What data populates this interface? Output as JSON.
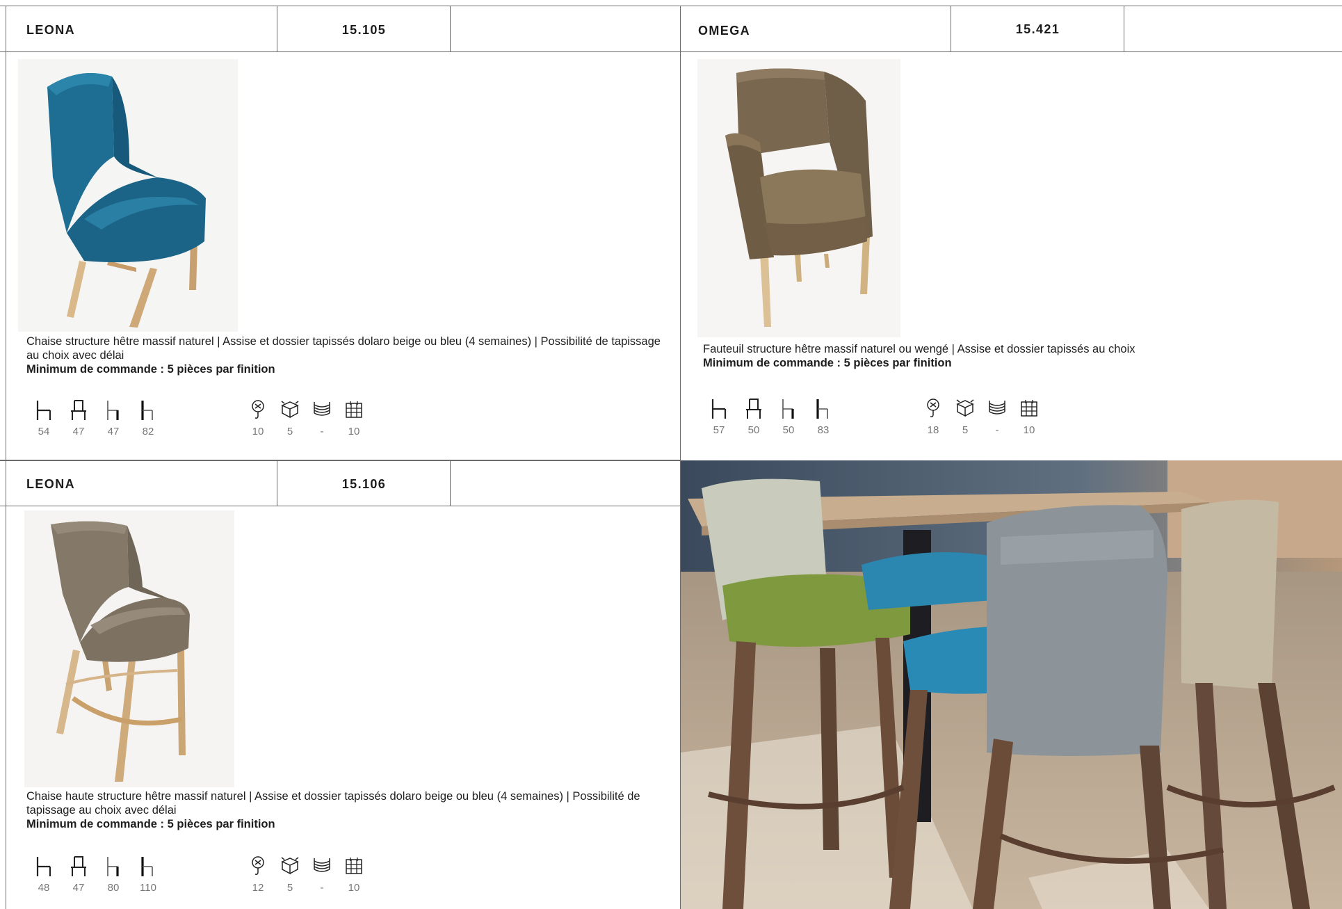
{
  "products": [
    {
      "name": "LEONA",
      "code": "15.105",
      "description": "Chaise structure hêtre massif naturel | Assise et dossier tapissés dolaro beige ou bleu (4 semaines) | Possibilité de tapissage au choix avec délai",
      "minimum": "Minimum de commande : 5 pièces par finition",
      "dimensions": [
        "54",
        "47",
        "47",
        "82"
      ],
      "logistics": [
        "10",
        "5",
        "-",
        "10"
      ],
      "image": "blue-chair-photo",
      "upholstery_color": "#1f6f93"
    },
    {
      "name": "OMEGA",
      "code": "15.421",
      "description": "Fauteuil structure hêtre massif naturel ou wengé | Assise et dossier tapissés au choix",
      "minimum": "Minimum de commande : 5 pièces par finition",
      "dimensions": [
        "57",
        "50",
        "50",
        "83"
      ],
      "logistics": [
        "18",
        "5",
        "-",
        "10"
      ],
      "image": "brown-armchair-photo",
      "upholstery_color": "#7d6a52"
    },
    {
      "name": "LEONA",
      "code": "15.106",
      "description": "Chaise haute structure hêtre massif naturel | Assise et dossier tapissés dolaro beige ou bleu (4 semaines) | Possibilité de tapissage au choix avec délai",
      "minimum": "Minimum de commande : 5 pièces par finition",
      "dimensions": [
        "48",
        "47",
        "80",
        "110"
      ],
      "logistics": [
        "12",
        "5",
        "-",
        "10"
      ],
      "image": "taupe-bar-stool-photo",
      "upholstery_color": "#8a8070"
    }
  ],
  "icons": {
    "dimensions": [
      "depth-icon",
      "width-icon",
      "seat-height-icon",
      "total-height-icon"
    ],
    "logistics": [
      "weight-icon",
      "box-icon",
      "stacking-icon",
      "packaging-icon"
    ]
  },
  "lifestyle_image": "bar-stools-lifestyle-photo"
}
